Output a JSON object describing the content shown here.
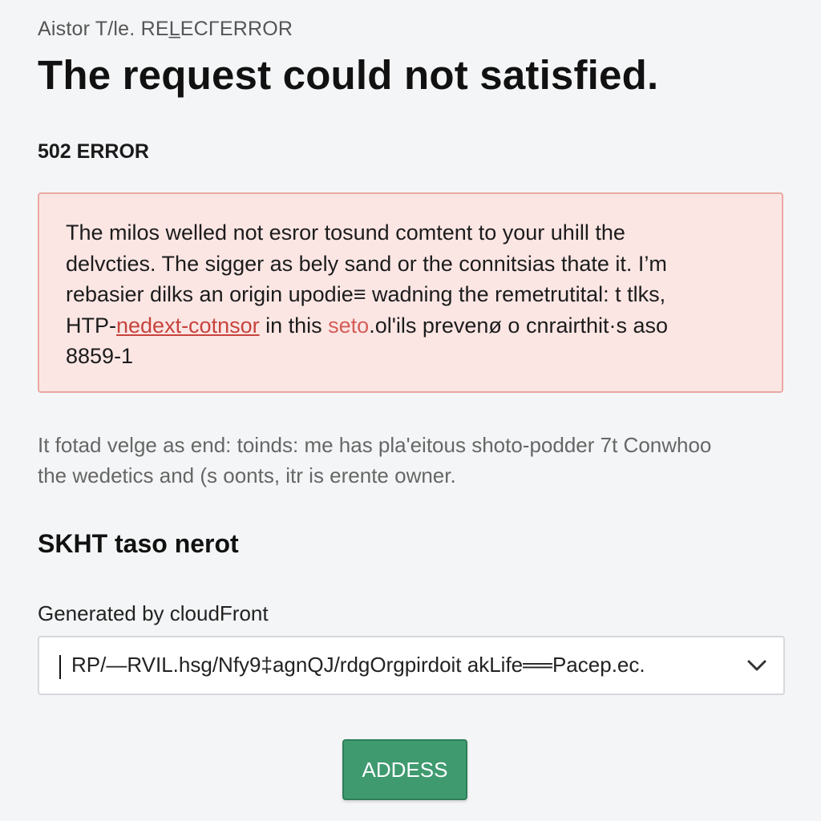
{
  "header": {
    "small_title": "Aistor T/le. REL̲ECΓERROR",
    "headline": "The request could not satisfied."
  },
  "error_code": "502 ERROR",
  "alert": {
    "line1": "The mi​los welled not esror tosund comtent to your uhill the",
    "line2": "delvcties. The sigger as bely sand or the connitsias thate it. I’m",
    "line3": "rebasier dilks an origin upodie≡ wadning the remetrutital: t tlks,",
    "line4_prefix": "HTP-",
    "line4_link": "nedext-cotnsor",
    "line4_mid": " in this ",
    "line4_accent": "seto",
    "line4_suffix": ".ol'ils prevenø o cnrairthit·s aso",
    "line5": "8859-1"
  },
  "info": {
    "line1": "It fotad velge as end: toinds: me has pla'eitous shoto-podder 7t Conwhoo",
    "line2": "the wedetics and (s oonts, itr is erente owner."
  },
  "subheading": "SKHT taso nerot",
  "generated": {
    "label": "Generated by cloudFront",
    "select_value": "RP/—RVIL.hsg/Nfy9‡agnQJ/rdgOrgpirdoit akLife══Pacep.ec."
  },
  "button": {
    "label": "ADDESS"
  },
  "icons": {
    "dropdown": "chevron-down-icon"
  },
  "colors": {
    "background": "#f4f5f6",
    "alert_bg": "#fbe6e4",
    "alert_border": "#eaa8a2",
    "link": "#c8433d",
    "button": "#3f9a70"
  }
}
